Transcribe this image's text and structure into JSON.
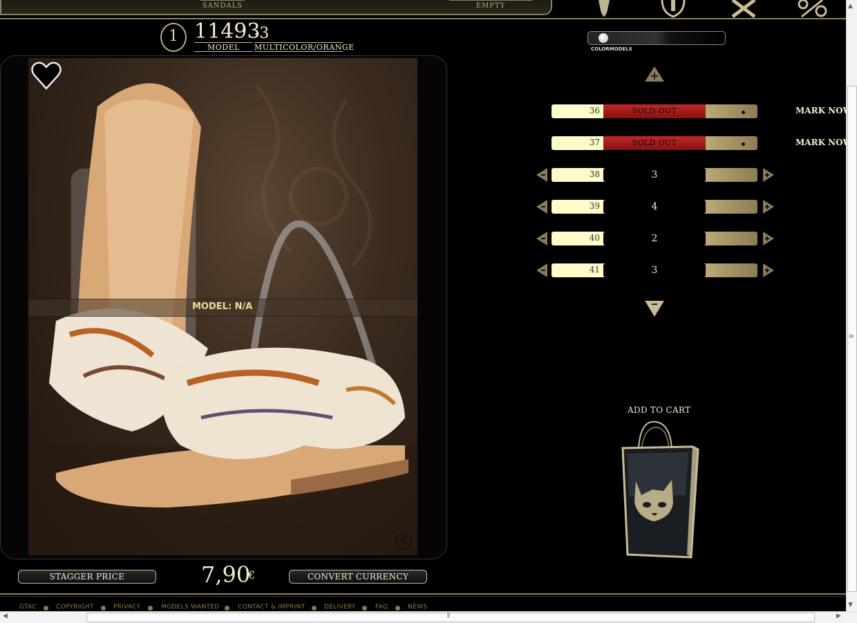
{
  "topnav": {
    "left_label": "SANDALS",
    "right_label": "EMPTY"
  },
  "product": {
    "badge": "1",
    "model_number": "11493",
    "model_suffix": "-3",
    "model_label": "MODEL",
    "color_label": "MULTICOLOR/ORANGE",
    "overlay_model_text": "MODEL:  N/A",
    "copyright_symbol": "©"
  },
  "pricing": {
    "stagger_price_label": "STAGGER PRICE",
    "price": "7,90",
    "currency": "€",
    "convert_currency_label": "CONVERT CURRENCY"
  },
  "colormodels": {
    "label": "COLORMODELS"
  },
  "sizes": [
    {
      "size": "36",
      "status": "SOLD OUT",
      "mark_now": "MARK NOW"
    },
    {
      "size": "37",
      "status": "SOLD OUT",
      "mark_now": "MARK NOW"
    },
    {
      "size": "38",
      "qty": "3"
    },
    {
      "size": "39",
      "qty": "4"
    },
    {
      "size": "40",
      "qty": "2"
    },
    {
      "size": "41",
      "qty": "3"
    }
  ],
  "cart": {
    "add_to_cart_label": "ADD TO CART"
  },
  "footer": {
    "links": [
      "GTAC",
      "COPYRIGHT",
      "PRIVACY",
      "MODELS WANTED",
      "CONTACT & IMPRINT",
      "DELIVERY",
      "FAQ",
      "NEWS"
    ]
  },
  "colors": {
    "accent_gold": "#c8bc98",
    "sold_out_red": "#b01e1e",
    "background": "#000000"
  },
  "icons": [
    "statue-icon",
    "crest-icon",
    "x-letter-icon",
    "percent-icon",
    "heart-icon",
    "plus-triangle-icon",
    "minus-triangle-icon",
    "shopping-bag-icon"
  ]
}
